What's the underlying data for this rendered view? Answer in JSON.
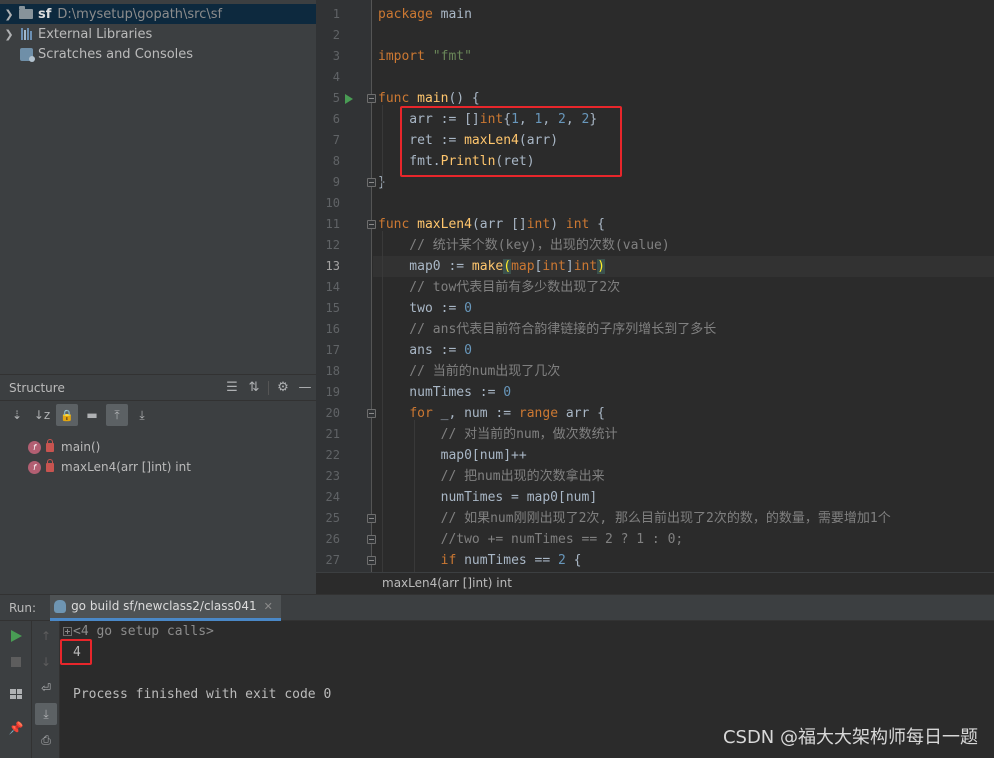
{
  "project": {
    "items": [
      {
        "name": "sf",
        "path": "D:\\mysetup\\gopath\\src\\sf",
        "icon": "folder-icon",
        "expanded": false
      },
      {
        "name": "External Libraries",
        "path": "",
        "icon": "library-icon",
        "expanded": false
      },
      {
        "name": "Scratches and Consoles",
        "path": "",
        "icon": "scratches-icon",
        "expanded": false
      }
    ]
  },
  "structure": {
    "title": "Structure",
    "items": [
      {
        "label": "main()"
      },
      {
        "label": "maxLen4(arr []int) int"
      }
    ]
  },
  "editor": {
    "current_line": 13,
    "lines": [
      [
        {
          "t": "package ",
          "c": "kw"
        },
        {
          "t": "main",
          "c": ""
        }
      ],
      [],
      [
        {
          "t": "import ",
          "c": "kw"
        },
        {
          "t": "\"fmt\"",
          "c": "str"
        }
      ],
      [],
      [
        {
          "t": "func ",
          "c": "kw"
        },
        {
          "t": "main",
          "c": "fn"
        },
        {
          "t": "() {",
          "c": ""
        }
      ],
      [
        {
          "t": "    arr := []",
          "c": ""
        },
        {
          "t": "int",
          "c": "kw"
        },
        {
          "t": "{",
          "c": ""
        },
        {
          "t": "1",
          "c": "num"
        },
        {
          "t": ", ",
          "c": ""
        },
        {
          "t": "1",
          "c": "num"
        },
        {
          "t": ", ",
          "c": ""
        },
        {
          "t": "2",
          "c": "num"
        },
        {
          "t": ", ",
          "c": ""
        },
        {
          "t": "2",
          "c": "num"
        },
        {
          "t": "}",
          "c": ""
        }
      ],
      [
        {
          "t": "    ret := ",
          "c": ""
        },
        {
          "t": "maxLen4",
          "c": "fn"
        },
        {
          "t": "(arr)",
          "c": ""
        }
      ],
      [
        {
          "t": "    fmt.",
          "c": ""
        },
        {
          "t": "Println",
          "c": "fn"
        },
        {
          "t": "(ret)",
          "c": ""
        }
      ],
      [
        {
          "t": "}",
          "c": ""
        }
      ],
      [],
      [
        {
          "t": "func ",
          "c": "kw"
        },
        {
          "t": "maxLen4",
          "c": "fn"
        },
        {
          "t": "(arr []",
          "c": ""
        },
        {
          "t": "int",
          "c": "kw"
        },
        {
          "t": ") ",
          "c": ""
        },
        {
          "t": "int",
          "c": "kw"
        },
        {
          "t": " {",
          "c": ""
        }
      ],
      [
        {
          "t": "    // 统计某个数(key)，出现的次数(value)",
          "c": "cm"
        }
      ],
      [
        {
          "t": "    map0 := ",
          "c": ""
        },
        {
          "t": "make",
          "c": "fn"
        },
        {
          "t": "(",
          "c": "bracket"
        },
        {
          "t": "map",
          "c": "kw"
        },
        {
          "t": "[",
          "c": ""
        },
        {
          "t": "int",
          "c": "kw"
        },
        {
          "t": "]",
          "c": ""
        },
        {
          "t": "int",
          "c": "kw"
        },
        {
          "t": ")",
          "c": "bracket"
        }
      ],
      [
        {
          "t": "    // tow代表目前有多少数出现了2次",
          "c": "cm"
        }
      ],
      [
        {
          "t": "    two := ",
          "c": ""
        },
        {
          "t": "0",
          "c": "num"
        }
      ],
      [
        {
          "t": "    // ans代表目前符合韵律链接的子序列增长到了多长",
          "c": "cm"
        }
      ],
      [
        {
          "t": "    ans := ",
          "c": ""
        },
        {
          "t": "0",
          "c": "num"
        }
      ],
      [
        {
          "t": "    // 当前的num出现了几次",
          "c": "cm"
        }
      ],
      [
        {
          "t": "    numTimes := ",
          "c": ""
        },
        {
          "t": "0",
          "c": "num"
        }
      ],
      [
        {
          "t": "    ",
          "c": ""
        },
        {
          "t": "for ",
          "c": "kw"
        },
        {
          "t": "_, num := ",
          "c": ""
        },
        {
          "t": "range ",
          "c": "kw"
        },
        {
          "t": "arr {",
          "c": ""
        }
      ],
      [
        {
          "t": "        // 对当前的num，做次数统计",
          "c": "cm"
        }
      ],
      [
        {
          "t": "        map0[num]++",
          "c": ""
        }
      ],
      [
        {
          "t": "        // 把num出现的次数拿出来",
          "c": "cm"
        }
      ],
      [
        {
          "t": "        numTimes = map0[num]",
          "c": ""
        }
      ],
      [
        {
          "t": "        // 如果num刚刚出现了2次, 那么目前出现了2次的数，的数量，需要增加1个",
          "c": "cm"
        }
      ],
      [
        {
          "t": "        //two += numTimes == 2 ? 1 : 0;",
          "c": "cm"
        }
      ],
      [
        {
          "t": "        ",
          "c": ""
        },
        {
          "t": "if ",
          "c": "kw"
        },
        {
          "t": "numTimes == ",
          "c": ""
        },
        {
          "t": "2",
          "c": "num"
        },
        {
          "t": " {",
          "c": ""
        }
      ]
    ],
    "breadcrumb": "maxLen4(arr []int) int"
  },
  "run": {
    "title": "Run:",
    "tab_label": "go build sf/newclass2/class041",
    "console": {
      "setup_calls": "<4 go setup calls>",
      "output": "4",
      "exit_message": "Process finished with exit code 0"
    }
  },
  "watermark": "CSDN @福大大架构师每日一题",
  "colors": {
    "keyword": "#cc7832",
    "function": "#ffc66d",
    "string": "#6a8759",
    "number": "#6897bb",
    "comment": "#808080",
    "highlight_box": "#e8262b"
  }
}
